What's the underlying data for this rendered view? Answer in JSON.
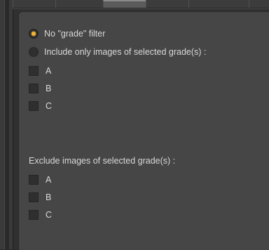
{
  "grade_filter": {
    "options": [
      {
        "label": "No \"grade\" filter",
        "selected": true
      },
      {
        "label": "Include only images of selected grade(s) :",
        "selected": false
      }
    ],
    "include_grades": [
      {
        "label": "A",
        "checked": false
      },
      {
        "label": "B",
        "checked": false
      },
      {
        "label": "C",
        "checked": false
      }
    ],
    "exclude_heading": "Exclude images of selected grade(s) :",
    "exclude_grades": [
      {
        "label": "A",
        "checked": false
      },
      {
        "label": "B",
        "checked": false
      },
      {
        "label": "C",
        "checked": false
      }
    ]
  },
  "colors": {
    "accent": "#f2b532",
    "panel": "#464646",
    "text": "#d8d8d8"
  }
}
